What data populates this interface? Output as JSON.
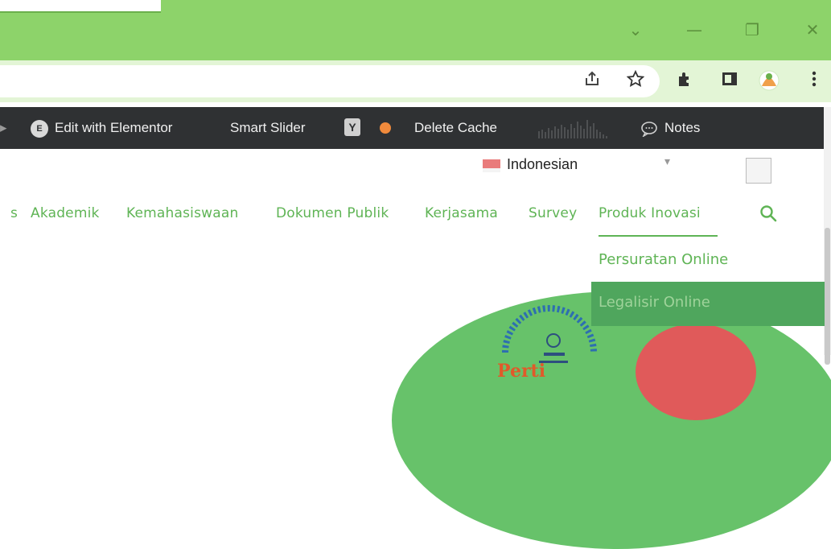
{
  "window": {
    "controls": {
      "chevron": "⌄",
      "minimize": "—",
      "restore": "❐",
      "close": "✕"
    },
    "title_color": "#8dd36a"
  },
  "toolbar": {
    "icons": [
      "share-icon",
      "star-icon",
      "extensions-icon",
      "side-panel-icon",
      "profile-icon",
      "menu-icon"
    ]
  },
  "adminbar": {
    "edit_elementor": "Edit with Elementor",
    "smart_slider": "Smart Slider",
    "delete_cache": "Delete Cache",
    "notes": "Notes",
    "elementor_glyph": "E",
    "yoast_glyph": "Y"
  },
  "page": {
    "language": "Indonesian",
    "nav": {
      "partial": "s",
      "items": [
        "Akademik",
        "Kemahasiswaan",
        "Dokumen Publik",
        "Kerjasama",
        "Survey",
        "Produk Inovasi"
      ]
    },
    "dropdown": [
      "Persuratan Online",
      "Legalisir Online"
    ],
    "colors": {
      "accent": "#5fb455",
      "admin_bar": "#2f3133",
      "hover": "#4fa65d"
    }
  }
}
